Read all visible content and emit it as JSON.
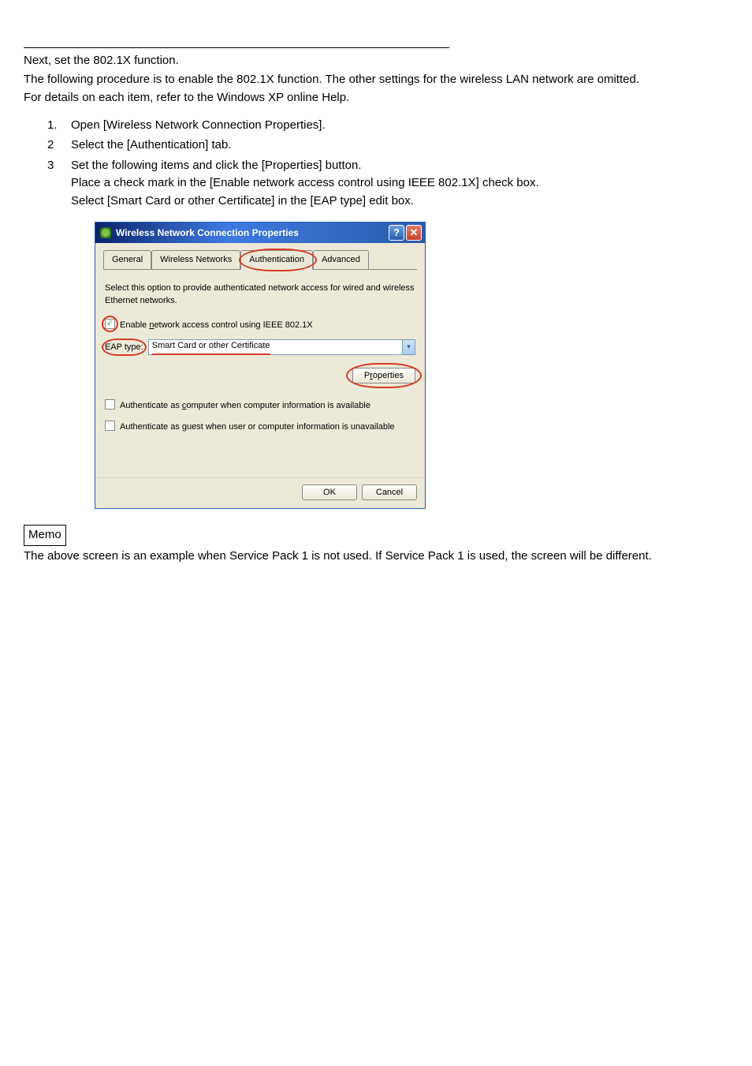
{
  "doc": {
    "line1": "Next, set the 802.1X function.",
    "line2": "The following procedure is to enable the 802.1X function.  The other settings for the wireless LAN network are omitted.",
    "line3": "For details on each item, refer to the Windows XP online Help.",
    "steps": [
      {
        "num": "1.",
        "lines": [
          "Open [Wireless Network Connection Properties]."
        ]
      },
      {
        "num": "2",
        "lines": [
          "Select the [Authentication] tab."
        ]
      },
      {
        "num": "3",
        "lines": [
          "Set the following items and click the [Properties] button.",
          "Place a check mark in the [Enable network access control using IEEE 802.1X] check box.",
          "Select [Smart Card or other Certificate] in the [EAP type] edit box."
        ]
      }
    ],
    "memo_label": "Memo",
    "memo_text": "The above screen is an example when Service Pack 1 is not used.  If Service Pack 1 is used, the screen will be different."
  },
  "dialog": {
    "title": "Wireless Network Connection Properties",
    "tabs": {
      "general": "General",
      "wireless": "Wireless Networks",
      "authentication": "Authentication",
      "advanced": "Advanced"
    },
    "desc": "Select this option to provide authenticated network access for wired and wireless Ethernet networks.",
    "enable_label_pre": "Enable ",
    "enable_label_u": "n",
    "enable_label_post": "etwork access control using IEEE 802.1X",
    "eap_label_pre": "EAP ",
    "eap_label_rest": "type:",
    "eap_value": "Smart Card or other Certificate",
    "properties_btn_pre": "P",
    "properties_btn_u": "r",
    "properties_btn_post": "operties",
    "auth_computer_pre": "Authenticate as ",
    "auth_computer_u": "c",
    "auth_computer_post": "omputer when computer information is available",
    "auth_guest_pre": "Authenticate as ",
    "auth_guest_u": "g",
    "auth_guest_post": "uest when user or computer information is unavailable",
    "ok_btn": "OK",
    "cancel_btn": "Cancel"
  }
}
